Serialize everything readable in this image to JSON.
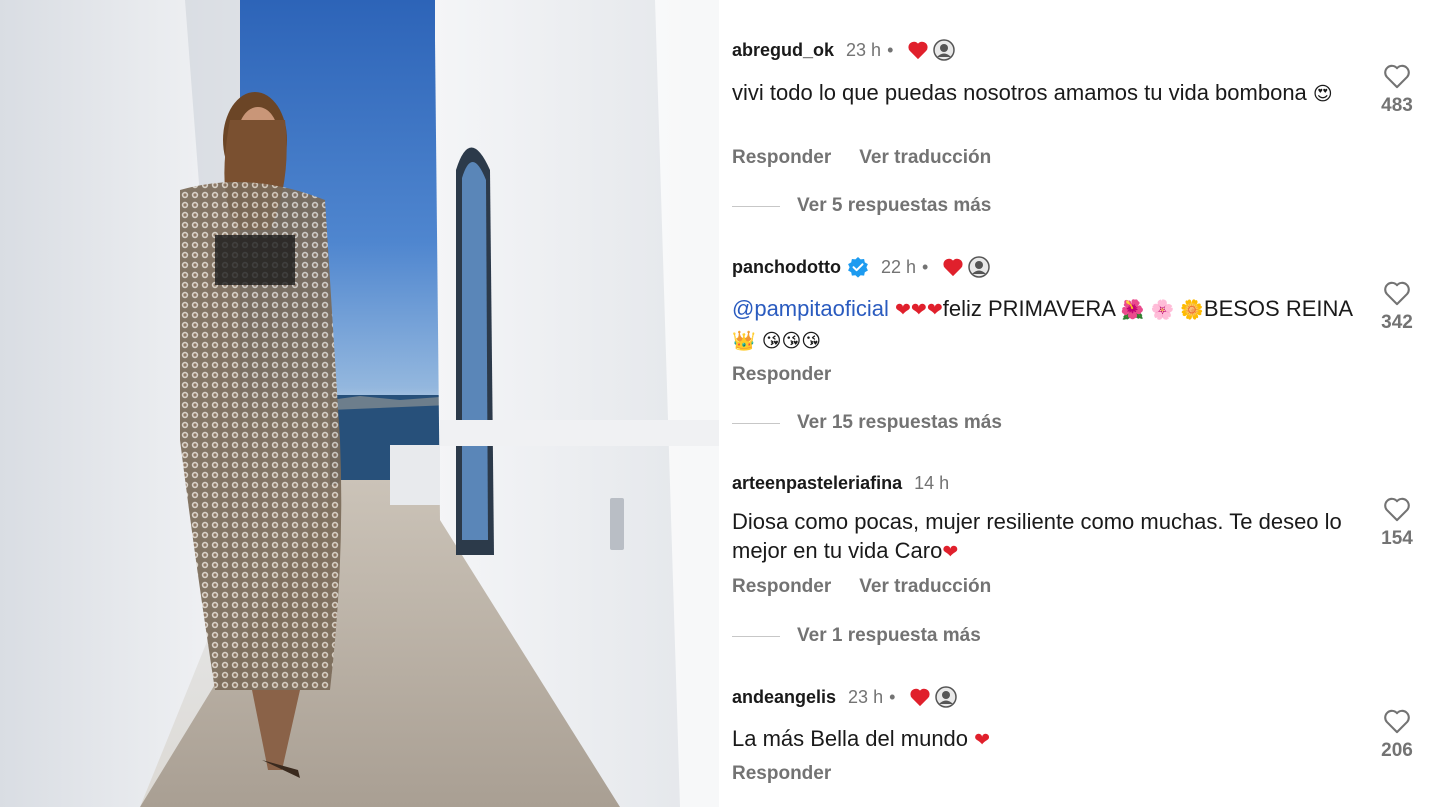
{
  "photo": {
    "description_icon": "photo-image"
  },
  "comments": [
    {
      "username": "abregud_ok",
      "time": "23 h",
      "has_author_like": true,
      "verified": false,
      "text_parts": [
        {
          "type": "text",
          "value": "vivi todo lo que puedas nosotros amamos tu vida bombona "
        },
        {
          "type": "emoji",
          "value": "😍"
        }
      ],
      "actions": [
        "Responder",
        "Ver traducción"
      ],
      "likes": "483",
      "replies": "Ver 5 respuestas más"
    },
    {
      "username": "panchodotto",
      "time": "22 h",
      "has_author_like": true,
      "verified": true,
      "text_parts": [
        {
          "type": "mention",
          "value": "@pampitaoficial"
        },
        {
          "type": "text",
          "value": " "
        },
        {
          "type": "emoji-red",
          "value": "❤❤❤"
        },
        {
          "type": "text",
          "value": "feliz PRIMAVERA "
        },
        {
          "type": "emoji",
          "value": "🌺 🌸 🌼"
        },
        {
          "type": "text",
          "value": "BESOS REINA "
        },
        {
          "type": "emoji",
          "value": "👑  😘😘😘"
        }
      ],
      "actions": [
        "Responder"
      ],
      "likes": "342",
      "replies": "Ver 15 respuestas más"
    },
    {
      "username": "arteenpasteleriafina",
      "time": "14 h",
      "has_author_like": false,
      "verified": false,
      "text_parts": [
        {
          "type": "text",
          "value": "Diosa como pocas, mujer resiliente como muchas. Te deseo lo mejor en tu vida Caro"
        },
        {
          "type": "emoji-red",
          "value": "❤"
        }
      ],
      "actions": [
        "Responder",
        "Ver traducción"
      ],
      "likes": "154",
      "replies": "Ver 1 respuesta más"
    },
    {
      "username": "andeangelis",
      "time": "23 h",
      "has_author_like": true,
      "verified": false,
      "text_parts": [
        {
          "type": "text",
          "value": "La más Bella  del mundo "
        },
        {
          "type": "emoji-red",
          "value": "❤"
        }
      ],
      "actions": [
        "Responder"
      ],
      "likes": "206",
      "replies": ""
    }
  ],
  "icons": {
    "like": "heart-outline-icon",
    "author_like": "heart-filled-icon",
    "verified": "verified-badge-icon"
  },
  "colors": {
    "mention": "#2a5bbf",
    "heart": "#e0202c",
    "muted": "#737373",
    "verified": "#1d9bf0"
  }
}
